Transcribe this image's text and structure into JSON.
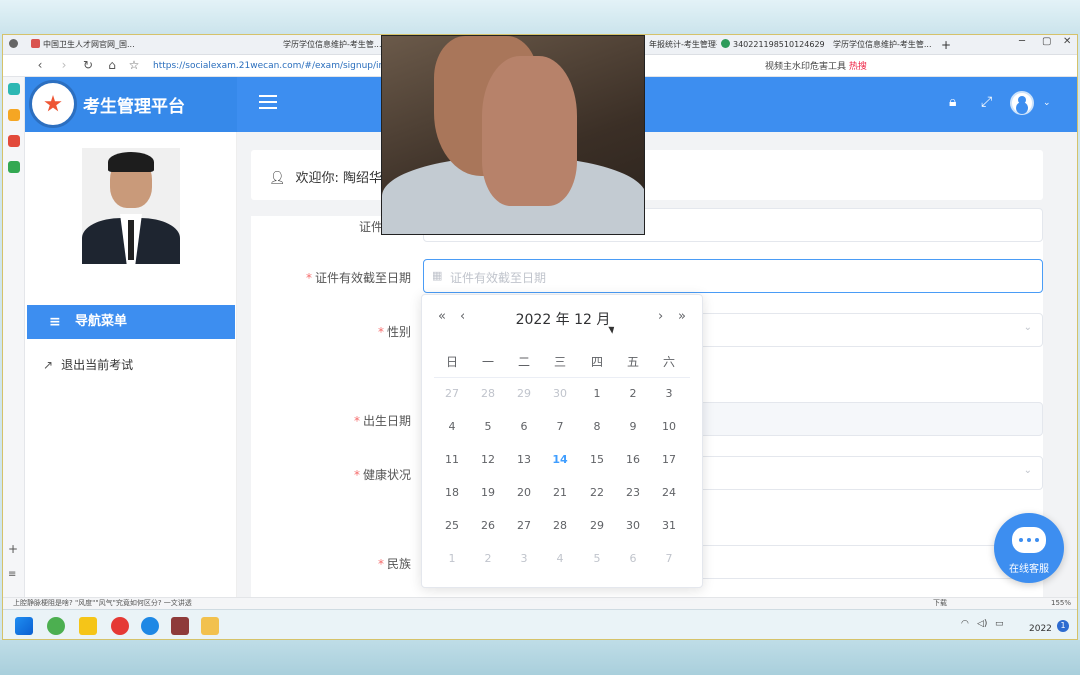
{
  "browser": {
    "tabs": [
      {
        "label": "中国卫生人才网官网_国..."
      },
      {
        "label": "学历学位信息维护-考生管..."
      },
      {
        "label": "年报统计-考生管理平..."
      },
      {
        "label": "340221198510124629"
      },
      {
        "label": "学历学位信息维护-考生管..."
      }
    ],
    "new_tab": "+",
    "url": "https://socialexam.21wecan.com/#/exam/signup/ind",
    "search_hint": "视频主水印危害工具",
    "hot_label": "热搜",
    "win_min": "─",
    "win_max": "▢",
    "win_close": "✕"
  },
  "app": {
    "title": "考生管理平台",
    "nav_menu_label": "导航菜单",
    "exit_label": "退出当前考试",
    "welcome_text": "欢迎你: 陶绍华"
  },
  "form": {
    "field_cert_partial": "证件",
    "cert_expiry_label": "证件有效截至日期",
    "cert_expiry_placeholder": "证件有效截至日期",
    "gender_label": "性别",
    "birth_label": "出生日期",
    "health_label": "健康状况",
    "ethnicity_label": "民族",
    "required_mark": "*"
  },
  "datepicker": {
    "year_month": "2022 年  12 月",
    "prev_year": "«",
    "prev_month": "‹",
    "next_month": "›",
    "next_year": "»",
    "weekdays": [
      "日",
      "一",
      "二",
      "三",
      "四",
      "五",
      "六"
    ],
    "weeks": [
      [
        {
          "d": "27",
          "o": true
        },
        {
          "d": "28",
          "o": true
        },
        {
          "d": "29",
          "o": true
        },
        {
          "d": "30",
          "o": true
        },
        {
          "d": "1"
        },
        {
          "d": "2"
        },
        {
          "d": "3"
        }
      ],
      [
        {
          "d": "4"
        },
        {
          "d": "5"
        },
        {
          "d": "6"
        },
        {
          "d": "7"
        },
        {
          "d": "8"
        },
        {
          "d": "9"
        },
        {
          "d": "10"
        }
      ],
      [
        {
          "d": "11"
        },
        {
          "d": "12"
        },
        {
          "d": "13"
        },
        {
          "d": "14",
          "t": true
        },
        {
          "d": "15"
        },
        {
          "d": "16"
        },
        {
          "d": "17"
        }
      ],
      [
        {
          "d": "18"
        },
        {
          "d": "19"
        },
        {
          "d": "20"
        },
        {
          "d": "21"
        },
        {
          "d": "22"
        },
        {
          "d": "23"
        },
        {
          "d": "24"
        }
      ],
      [
        {
          "d": "25"
        },
        {
          "d": "26"
        },
        {
          "d": "27"
        },
        {
          "d": "28"
        },
        {
          "d": "29"
        },
        {
          "d": "30"
        },
        {
          "d": "31"
        }
      ],
      [
        {
          "d": "1",
          "o": true
        },
        {
          "d": "2",
          "o": true
        },
        {
          "d": "3",
          "o": true
        },
        {
          "d": "4",
          "o": true
        },
        {
          "d": "5",
          "o": true
        },
        {
          "d": "6",
          "o": true
        },
        {
          "d": "7",
          "o": true
        }
      ]
    ]
  },
  "chat": {
    "label": "在线客服"
  },
  "statusbar": {
    "text": "上腔静脉梗阻是啥? \"风度\"\"风气\"究竟如何区分? 一文讲透",
    "download": "下载",
    "zoom": "155%"
  },
  "taskbar": {
    "clock": "2022",
    "notif_count": "1"
  },
  "colors": {
    "primary": "#3d8ef0",
    "required": "#f56c6c",
    "today": "#409eff"
  }
}
